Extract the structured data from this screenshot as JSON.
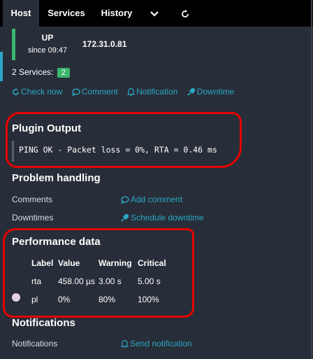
{
  "tabs": {
    "host": "Host",
    "services": "Services",
    "history": "History",
    "dropdown_icon": "chevron-down-icon",
    "refresh_icon": "refresh-icon"
  },
  "host": {
    "state": "UP",
    "since": "since 09:47",
    "address": "172.31.0.81",
    "services_label": "2 Services:",
    "services_count": "2"
  },
  "actions": {
    "check_now": "Check now",
    "comment": "Comment",
    "notification": "Notification",
    "downtime": "Downtime"
  },
  "plugin_output": {
    "title": "Plugin Output",
    "text": "PING OK - Packet loss = 0%, RTA = 0.46 ms"
  },
  "problem_handling": {
    "title": "Problem handling",
    "comments_label": "Comments",
    "add_comment": "Add comment",
    "downtimes_label": "Downtimes",
    "schedule_downtime": "Schedule downtime"
  },
  "performance": {
    "title": "Performance data",
    "headers": [
      "Label",
      "Value",
      "Warning",
      "Critical"
    ],
    "rows": [
      {
        "label": "rta",
        "value": "458.00 µs",
        "warning": "3.00 s",
        "critical": "5.00 s"
      },
      {
        "label": "pl",
        "value": "0%",
        "warning": "80%",
        "critical": "100%"
      }
    ]
  },
  "notifications": {
    "title": "Notifications",
    "label": "Notifications",
    "send": "Send notification"
  },
  "colors": {
    "background": "#282e39",
    "tabbar": "#000000",
    "ok": "#3cb66d",
    "link": "#2aa7c4",
    "annotation": "#e60000"
  }
}
